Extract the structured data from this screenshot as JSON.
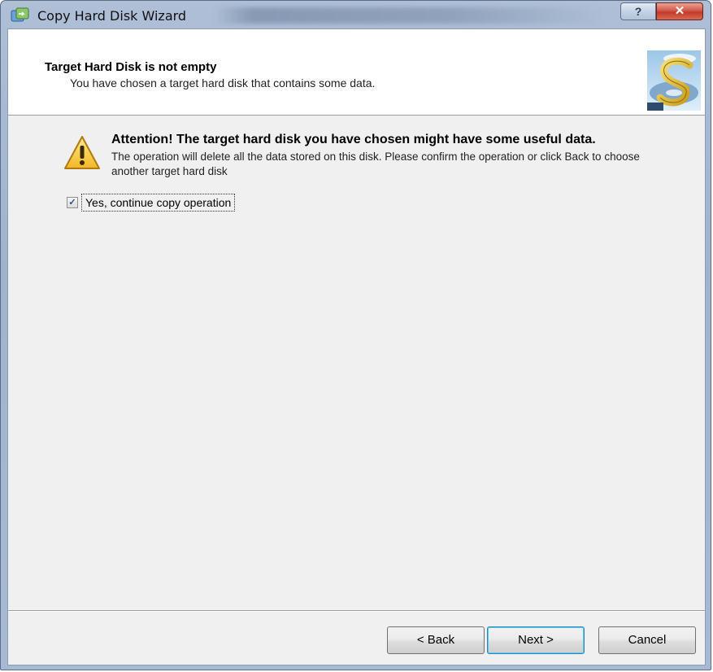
{
  "window": {
    "title": "Copy Hard Disk Wizard",
    "help_label": "?",
    "close_label": "✕"
  },
  "header": {
    "title": "Target Hard Disk is not empty",
    "subtitle": "You have chosen a target hard disk that contains some data."
  },
  "attention": {
    "title": "Attention! The target hard disk you have chosen might have some useful data.",
    "body": "The operation will delete all the data stored on this disk. Please confirm the operation or click Back to choose another target hard disk"
  },
  "confirm": {
    "checked": true,
    "check_mark": "✓",
    "label": "Yes, continue copy operation"
  },
  "buttons": {
    "back": "< Back",
    "next": "Next >",
    "cancel": "Cancel"
  },
  "colors": {
    "frame": "#a8bad3",
    "client_bg": "#f0f0f0",
    "header_bg": "#ffffff",
    "close_red": "#c23a2a",
    "default_button_border": "#3c7fb1"
  },
  "icons": {
    "app": "copy-disk-icon",
    "warning": "warning-triangle-icon",
    "header_logo": "wizard-logo-icon"
  }
}
